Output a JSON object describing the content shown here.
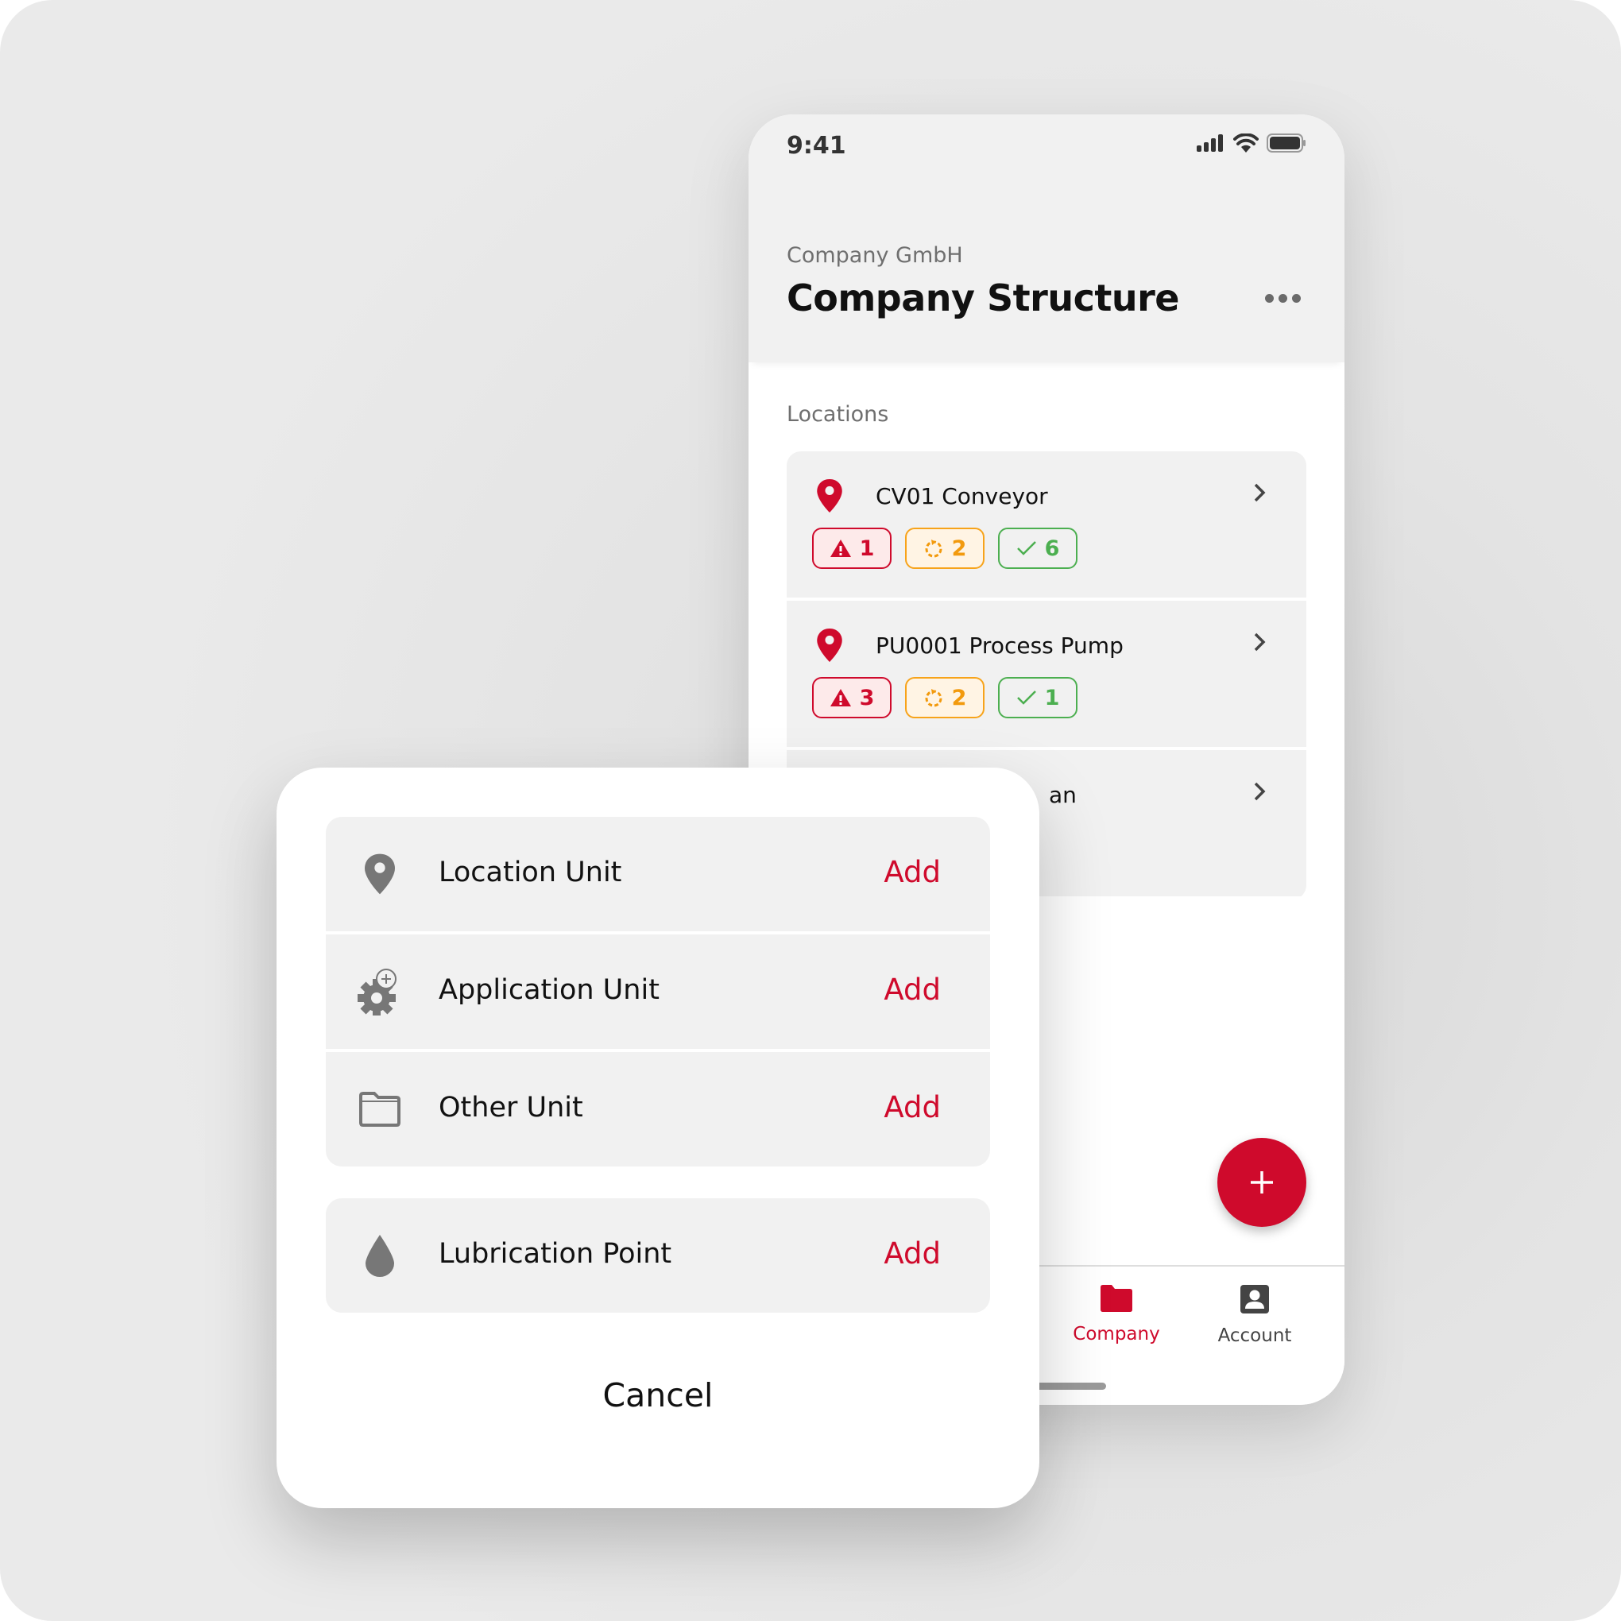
{
  "status_bar": {
    "time": "9:41",
    "icons": [
      "signal-icon",
      "wifi-icon",
      "battery-icon"
    ]
  },
  "header": {
    "company": "Company GmbH",
    "title": "Company Structure",
    "more_icon": "more-horizontal-icon"
  },
  "locations": {
    "section_label": "Locations",
    "items": [
      {
        "name": "CV01 Conveyor",
        "badges": {
          "alerts": "1",
          "pending": "2",
          "done": "6"
        }
      },
      {
        "name": "PU0001 Process Pump",
        "badges": {
          "alerts": "3",
          "pending": "2",
          "done": "1"
        }
      },
      {
        "name": "an"
      }
    ]
  },
  "fab": {
    "icon": "plus-icon"
  },
  "tabbar": {
    "items": [
      {
        "label": "Company",
        "icon": "folder-icon",
        "active": true
      },
      {
        "label": "Account",
        "icon": "account-icon",
        "active": false
      }
    ]
  },
  "colors": {
    "accent": "#cf0a2c",
    "warning": "#f29a0e",
    "success": "#4caf50",
    "icon_gray": "#777777"
  },
  "sheet": {
    "options": [
      {
        "label": "Location Unit",
        "icon": "location-pin-icon",
        "action": "Add"
      },
      {
        "label": "Application Unit",
        "icon": "gear-add-icon",
        "action": "Add"
      },
      {
        "label": "Other Unit",
        "icon": "folder-outline-icon",
        "action": "Add"
      },
      {
        "label": "Lubrication Point",
        "icon": "drop-icon",
        "action": "Add"
      }
    ],
    "cancel_label": "Cancel"
  }
}
